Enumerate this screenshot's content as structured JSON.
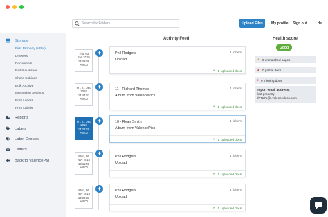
{
  "window": {
    "dot_colors": [
      "#ff5f57",
      "#febc2e",
      "#28c840"
    ]
  },
  "header": {
    "search_placeholder": "Search for Folders...",
    "upload_label": "Upload Files",
    "profile_label": "My profile",
    "signout_label": "Sign out",
    "lang_label": "de"
  },
  "sidebar": {
    "storage": "Storage",
    "sub_items": [
      "First Property (VPM)",
      "Drawers",
      "Documents",
      "Resolve issues",
      "Share Cabinet",
      "Bulk Archive",
      "Integration Settings",
      "Print Letters",
      "Print Labels"
    ],
    "reports": "Reports",
    "labels": "Labels",
    "label_groups": "Label Groups",
    "letters": "Letters",
    "back": "Back to ValencePM"
  },
  "feed": {
    "title": "Activity Feed",
    "items": [
      {
        "date_lines": [
          "Thu, 03",
          "Jan 2019",
          "13:49:38",
          "+0000"
        ],
        "title": "Phil Rodgers",
        "sub": "Upload",
        "folders": "1 folders",
        "docs_count": "1",
        "docs_label": "uploaded docs",
        "selected": false
      },
      {
        "date_lines": [
          "Fri, 21 Dec",
          "2018",
          "14:44:41",
          "+0000"
        ],
        "title": "11 - Richard Thomas",
        "sub": "Album from ValencePics",
        "folders": "1 folders",
        "docs_count": "1",
        "docs_label": "uploaded docs",
        "selected": false
      },
      {
        "date_lines": [
          "Fri, 21 Dec",
          "2018",
          "14:28:29",
          "+0000"
        ],
        "title": "10 - Ryan Smith",
        "sub": "Album from ValencePics",
        "folders": "1 folders",
        "docs_count": "1",
        "docs_label": "uploaded docs",
        "selected": true
      },
      {
        "date_lines": [
          "Mon, 26",
          "Nov 2018",
          "13:11:49",
          "+0000"
        ],
        "title": "Phil Rodgers",
        "sub": "Upload",
        "folders": "1 folders",
        "docs_count": "1",
        "docs_label": "uploaded docs",
        "selected": false
      },
      {
        "date_lines": [
          "Mon, 26",
          "Nov 2018",
          "13:09:33",
          "+0000"
        ],
        "title": "Phil Rodgers",
        "sub": "Upload",
        "folders": "1 folders",
        "docs_count": "1",
        "docs_label": "uploaded docs",
        "selected": false
      }
    ]
  },
  "health": {
    "title": "Health score",
    "badge": "Good",
    "badge_color": "#5fae3b",
    "unmatched": "0 unmatched pages",
    "partial": "0 partial docs",
    "missing": "0 missing docs",
    "email_label": "Import email address:",
    "email_line1": "first-property-",
    "email_line2": "d7717a@i.valencedocs.com"
  },
  "colors": {
    "accent": "#2d83c5",
    "selected_date": "#1f70b4",
    "success": "#3d8a3d"
  }
}
